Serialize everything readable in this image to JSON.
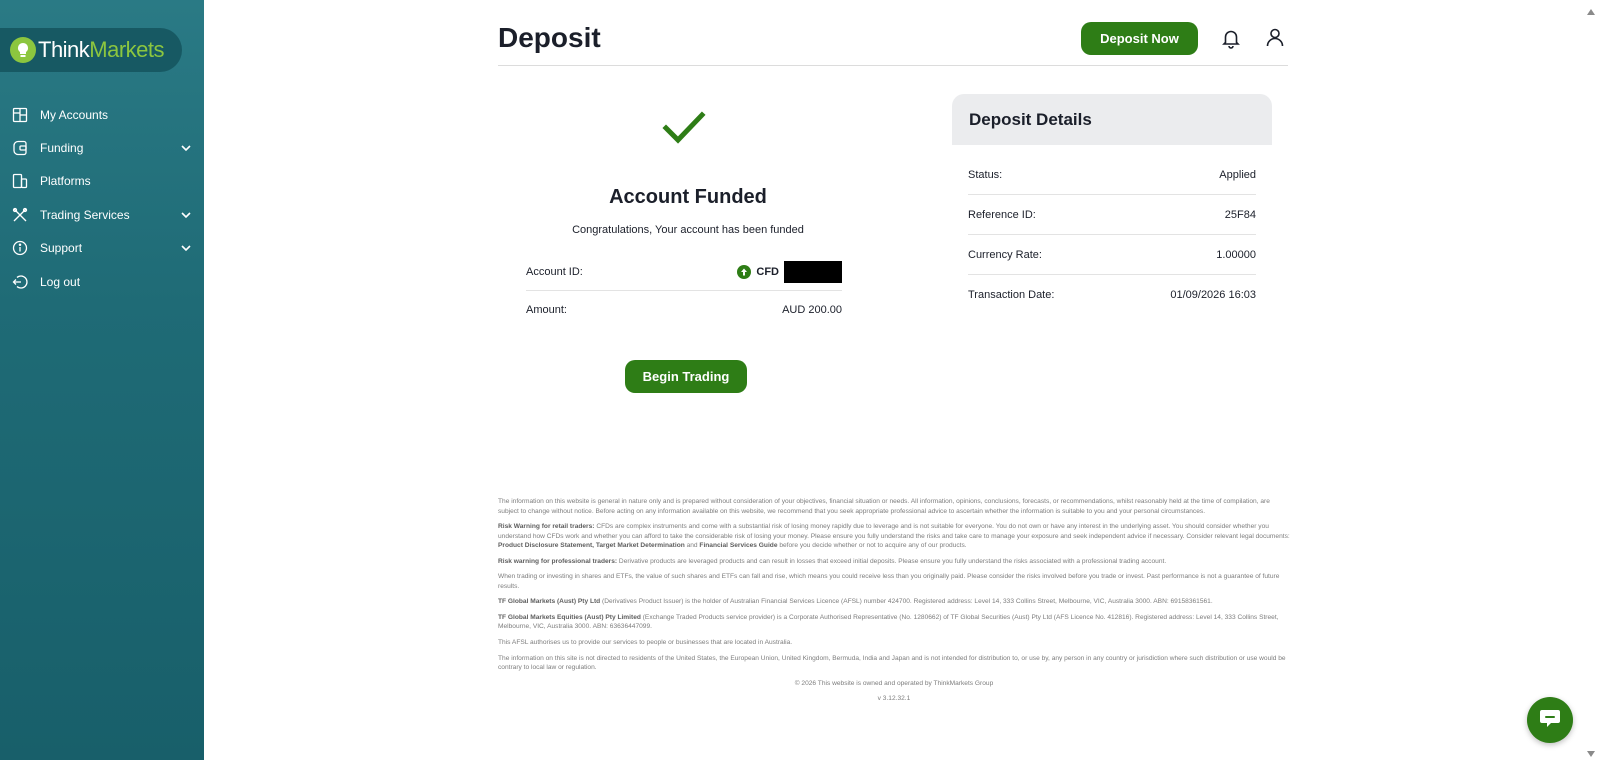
{
  "brand": {
    "think": "Think",
    "markets": "Markets"
  },
  "sidebar": {
    "items": [
      {
        "label": "My Accounts"
      },
      {
        "label": "Funding"
      },
      {
        "label": "Platforms"
      },
      {
        "label": "Trading Services"
      },
      {
        "label": "Support"
      },
      {
        "label": "Log out"
      }
    ]
  },
  "header": {
    "title": "Deposit",
    "deposit_now": "Deposit Now"
  },
  "result": {
    "title": "Account Funded",
    "subtitle": "Congratulations, Your account has been funded",
    "account_id_label": "Account ID:",
    "account_prefix": "CFD",
    "amount_label": "Amount:",
    "amount_value": "AUD 200.00",
    "begin_trading": "Begin Trading"
  },
  "details": {
    "title": "Deposit Details",
    "rows": [
      {
        "label": "Status:",
        "value": "Applied"
      },
      {
        "label": "Reference ID:",
        "value": "25F84"
      },
      {
        "label": "Currency Rate:",
        "value": "1.00000"
      },
      {
        "label": "Transaction Date:",
        "value": "01/09/2026 16:03"
      }
    ]
  },
  "disclaimer": {
    "p1": "The information on this website is general in nature only and is prepared without consideration of your objectives, financial situation or needs. All information, opinions, conclusions, forecasts, or recommendations, whilst reasonably held at the time of compilation, are subject to change without notice. Before acting on any information available on this website, we recommend that you seek appropriate professional advice to ascertain whether the information is suitable to you and your personal circumstances.",
    "p2_bold": "Risk Warning for retail traders:",
    "p2_text": " CFDs are complex instruments and come with a substantial risk of losing money rapidly due to leverage and is not suitable for everyone. You do not own or have any interest in the underlying asset. You should consider whether you understand how CFDs work and whether you can afford to take the considerable risk of losing your money. Please ensure you fully understand the risks and take care to manage your exposure and seek independent advice if necessary. Consider relevant legal documents: ",
    "p2_links": "Product Disclosure Statement, Target Market Determination",
    "p2_and": " and ",
    "p2_link2": "Financial Services Guide",
    "p2_end": " before you decide whether or not to acquire any of our products.",
    "p3_bold": "Risk warning for professional traders:",
    "p3_text": " Derivative products are leveraged products and can result in losses that exceed initial deposits. Please ensure you fully understand the risks associated with a professional trading account.",
    "p4": "When trading or investing in shares and ETFs, the value of such shares and ETFs can fall and rise, which means you could receive less than you originally paid. Please consider the risks involved before you trade or invest. Past performance is not a guarantee of future results.",
    "p5_bold": "TF Global Markets (Aust) Pty Ltd",
    "p5_text": " (Derivatives Product Issuer) is the holder of Australian Financial Services Licence (AFSL) number 424700. Registered address: Level 14, 333 Collins Street, Melbourne, VIC, Australia 3000. ABN: 69158361561.",
    "p6_bold": "TF Global Markets Equities (Aust) Pty Limited",
    "p6_text": " (Exchange Traded Products service provider) is a Corporate Authorised Representative (No. 1280662) of TF Global Securities (Aust) Pty Ltd (AFS Licence No. 412816). Registered address: Level 14, 333 Collins Street, Melbourne, VIC, Australia 3000. ABN: 63636447099.",
    "p7": "This AFSL authorises us to provide our services to people or businesses that are located in Australia.",
    "p8": "The information on this site is not directed to residents of the United States, the European Union, United Kingdom, Bermuda, India and Japan and is not intended for distribution to, or use by, any person in any country or jurisdiction where such distribution or use would be contrary to local law or regulation.",
    "copyright": "© 2026 This website is owned and operated by ThinkMarkets Group",
    "version": "v 3.12.32.1"
  },
  "colors": {
    "accent_green": "#2e7d16",
    "brand_lime": "#8cc63f",
    "sidebar_teal": "#1f6b76"
  }
}
